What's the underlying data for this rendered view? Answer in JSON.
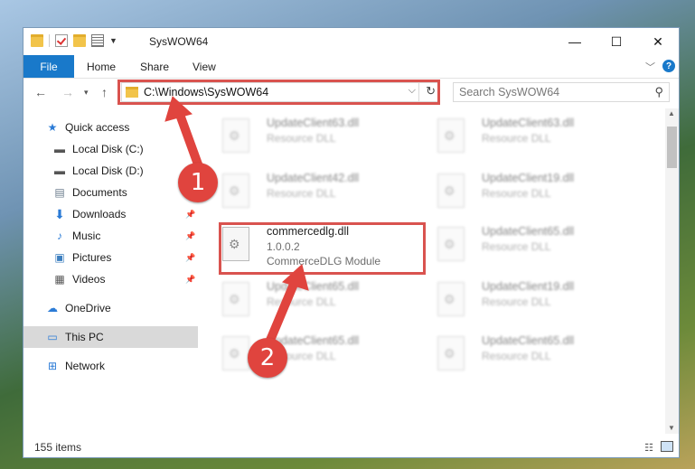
{
  "window": {
    "title": "SysWOW64",
    "controls": [
      "—",
      "☐",
      "✕"
    ]
  },
  "ribbon": {
    "tabs": [
      "File",
      "Home",
      "Share",
      "View"
    ],
    "help": "?"
  },
  "address": {
    "path": "C:\\Windows\\SysWOW64",
    "search_placeholder": "Search SysWOW64"
  },
  "sidebar": {
    "items": [
      {
        "label": "Quick access",
        "icon": "star-icon"
      },
      {
        "label": "Local Disk (C:)",
        "icon": "drive-icon"
      },
      {
        "label": "Local Disk (D:)",
        "icon": "drive-icon"
      },
      {
        "label": "Documents",
        "icon": "documents-icon"
      },
      {
        "label": "Downloads",
        "icon": "download-icon"
      },
      {
        "label": "Music",
        "icon": "music-icon"
      },
      {
        "label": "Pictures",
        "icon": "pictures-icon"
      },
      {
        "label": "Videos",
        "icon": "videos-icon"
      },
      {
        "label": "OneDrive",
        "icon": "cloud-icon"
      },
      {
        "label": "This PC",
        "icon": "pc-icon"
      },
      {
        "label": "Network",
        "icon": "network-icon"
      }
    ]
  },
  "files": [
    {
      "name": "UpdateClient63.dll",
      "type": "Resource DLL"
    },
    {
      "name": "UpdateClient63.dll",
      "type": "Resource DLL"
    },
    {
      "name": "UpdateClient42.dll",
      "type": "Resource DLL"
    },
    {
      "name": "UpdateClient19.dll",
      "type": "Resource DLL"
    },
    {
      "name": "commercedlg.dll",
      "version": "1.0.0.2",
      "type": "CommerceDLG Module"
    },
    {
      "name": "UpdateClient65.dll",
      "type": "Resource DLL"
    },
    {
      "name": "UpdateClient65.dll",
      "type": "Resource DLL"
    },
    {
      "name": "UpdateClient19.dll",
      "type": "Resource DLL"
    },
    {
      "name": "UpdateClient65.dll",
      "type": "Resource DLL"
    },
    {
      "name": "UpdateClient65.dll",
      "type": "Resource DLL"
    }
  ],
  "status": {
    "item_count": "155 items"
  },
  "annotations": {
    "step1": "1",
    "step2": "2",
    "color": "#e0443e"
  }
}
